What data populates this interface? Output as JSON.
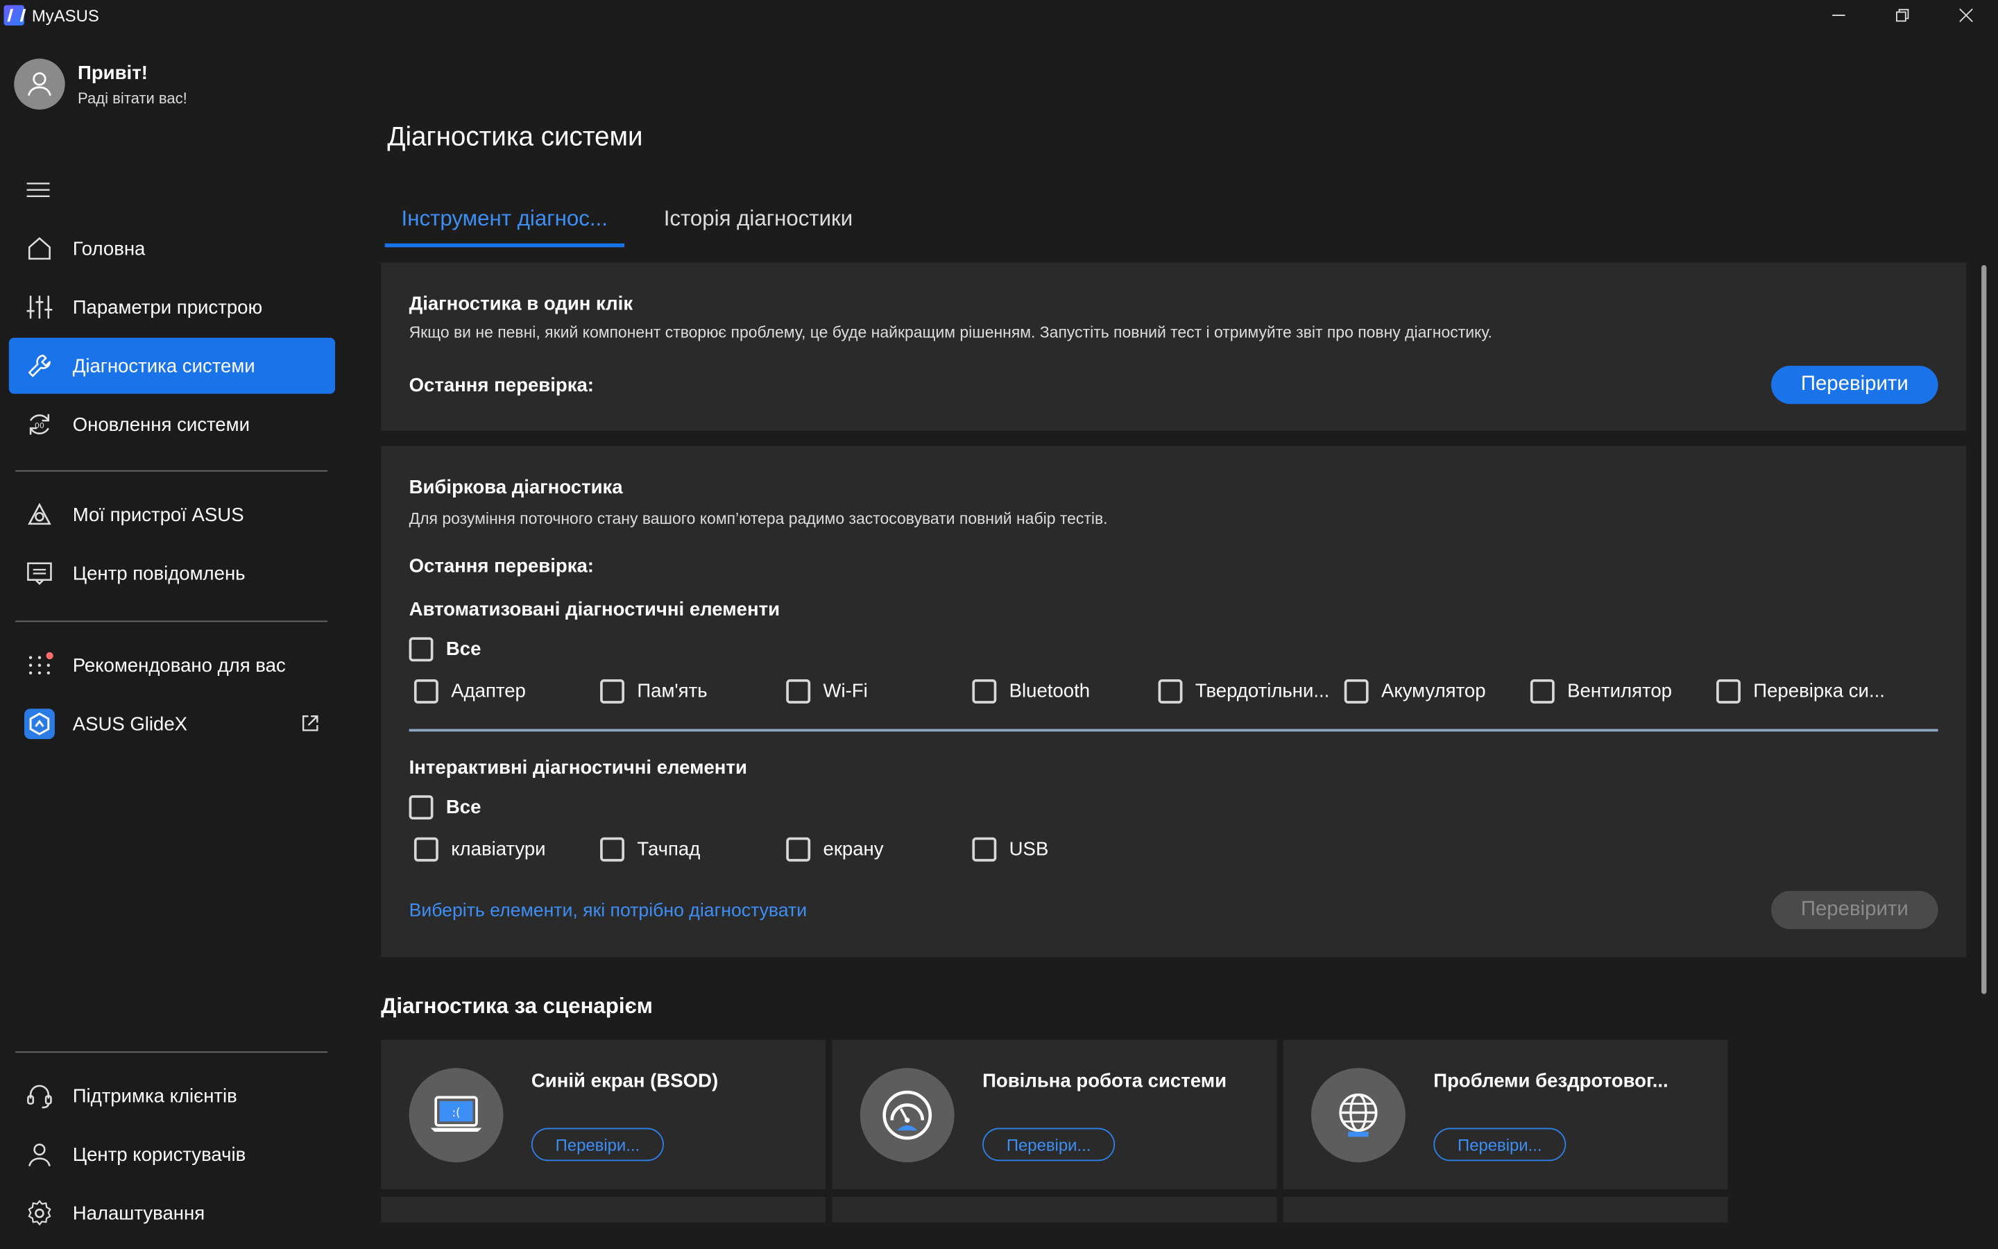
{
  "window": {
    "title": "MyASUS",
    "buttons": {
      "minimize": "—",
      "restore": "❐",
      "close": "✕"
    }
  },
  "profile": {
    "greeting": "Привіт!",
    "subtitle": "Раді вітати вас!"
  },
  "sidebar": {
    "items": [
      {
        "label": "Головна",
        "icon": "home-icon"
      },
      {
        "label": "Параметри пристрою",
        "icon": "sliders-icon"
      },
      {
        "label": "Діагностика системи",
        "icon": "wrench-icon",
        "active": true
      },
      {
        "label": "Оновлення системи",
        "icon": "update-icon"
      },
      {
        "label": "Мої пристрої ASUS",
        "icon": "devices-icon"
      },
      {
        "label": "Центр повідомлень",
        "icon": "message-icon"
      },
      {
        "label": "Рекомендовано для вас",
        "icon": "dots-grid-icon"
      },
      {
        "label": "ASUS GlideX",
        "icon": "glidex-icon"
      }
    ],
    "bottom": [
      {
        "label": "Підтримка клієнтів",
        "icon": "headset-icon"
      },
      {
        "label": "Центр користувачів",
        "icon": "user-icon"
      },
      {
        "label": "Налаштування",
        "icon": "gear-icon"
      }
    ]
  },
  "page": {
    "title": "Діагностика системи",
    "tabs": [
      "Інструмент діагнос...",
      "Історія діагностики"
    ]
  },
  "one_click": {
    "title": "Діагностика в один клік",
    "description": "Якщо ви не певні, який компонент створює проблему, це буде найкращим рішенням. Запустіть повний тест і отримуйте звіт про повну діагностику.",
    "last_check": "Остання перевірка:",
    "button": "Перевірити"
  },
  "custom": {
    "title": "Вибіркова діагностика",
    "description": "Для розуміння поточного стану вашого комп’ютера радимо застосовувати повний набір тестів.",
    "last_check": "Остання перевірка:",
    "auto_title": "Автоматизовані діагностичні елементи",
    "all_label": "Все",
    "auto_items": [
      "Адаптер",
      "Пам'ять",
      "Wi-Fi",
      "Bluetooth",
      "Твердотільни...",
      "Акумулятор",
      "Вентилятор",
      "Перевірка си..."
    ],
    "interactive_title": "Інтерактивні діагностичні елементи",
    "interactive_items": [
      "клавіатури",
      "Тачпад",
      "екрану",
      "USB"
    ],
    "hint": "Виберіть елементи, які потрібно діагностувати",
    "button": "Перевірити"
  },
  "scenario": {
    "title": "Діагностика за сценарієм",
    "cards": [
      {
        "title": "Синій екран (BSOD)",
        "button": "Перевіри...",
        "icon": "bsod-laptop-icon"
      },
      {
        "title": "Повільна робота системи",
        "button": "Перевіри...",
        "icon": "speedometer-icon"
      },
      {
        "title": "Проблеми бездротовог...",
        "button": "Перевіри...",
        "icon": "globe-icon"
      }
    ]
  }
}
